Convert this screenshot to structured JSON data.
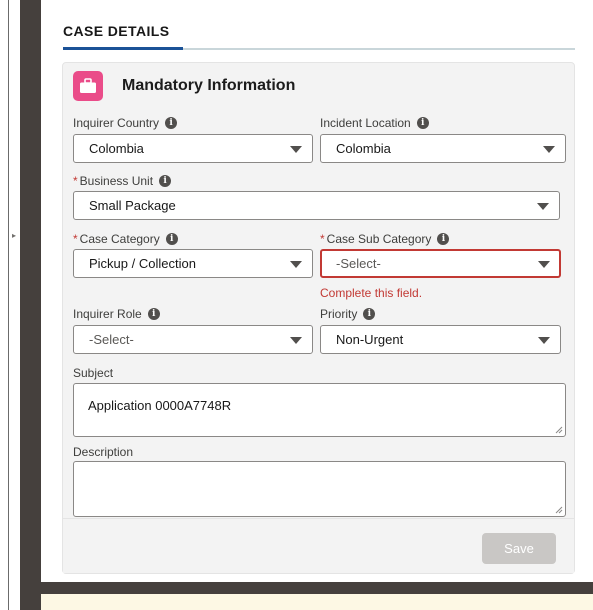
{
  "tab": {
    "title": "CASE DETAILS"
  },
  "card": {
    "title": "Mandatory Information",
    "icon": "briefcase-icon",
    "icon_color": "#ea4c89"
  },
  "fields": {
    "inquirer_country": {
      "label": "Inquirer Country",
      "value": "Colombia"
    },
    "incident_location": {
      "label": "Incident Location",
      "value": "Colombia"
    },
    "business_unit": {
      "label": "Business Unit",
      "value": "Small Package",
      "required": true
    },
    "case_category": {
      "label": "Case Category",
      "value": "Pickup / Collection",
      "required": true
    },
    "case_sub_category": {
      "label": "Case Sub Category",
      "value": "-Select-",
      "required": true,
      "error": "Complete this field."
    },
    "inquirer_role": {
      "label": "Inquirer Role",
      "value": "-Select-"
    },
    "priority": {
      "label": "Priority",
      "value": "Non-Urgent"
    },
    "subject": {
      "label": "Subject",
      "value": "Application 0000A7748R"
    },
    "description": {
      "label": "Description",
      "value": ""
    }
  },
  "required_marker": "*",
  "info_glyph": "i",
  "save_label": "Save",
  "colors": {
    "error": "#c23934",
    "accent": "#1b5297",
    "disabled_button": "#c9c7c5"
  }
}
